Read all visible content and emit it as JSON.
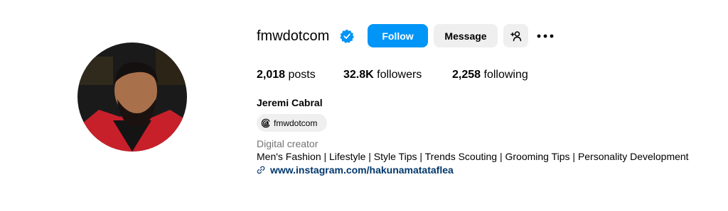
{
  "profile": {
    "username": "fmwdotcom",
    "verified_icon": "verified-badge-icon",
    "full_name": "Jeremi Cabral",
    "threads_handle": "fmwdotcom",
    "category": "Digital creator",
    "bio": "Men's Fashion | Lifestyle | Style Tips | Trends Scouting | Grooming Tips | Personality Development",
    "link": "www.instagram.com/hakunamatataflea"
  },
  "actions": {
    "follow_label": "Follow",
    "message_label": "Message"
  },
  "stats": {
    "posts_count": "2,018",
    "posts_label": "posts",
    "followers_count": "32.8K",
    "followers_label": "followers",
    "following_count": "2,258",
    "following_label": "following"
  },
  "colors": {
    "accent": "#0095f6",
    "verified": "#0095f6",
    "button_secondary": "#efefef",
    "link": "#00376b",
    "muted_text": "#737373"
  }
}
